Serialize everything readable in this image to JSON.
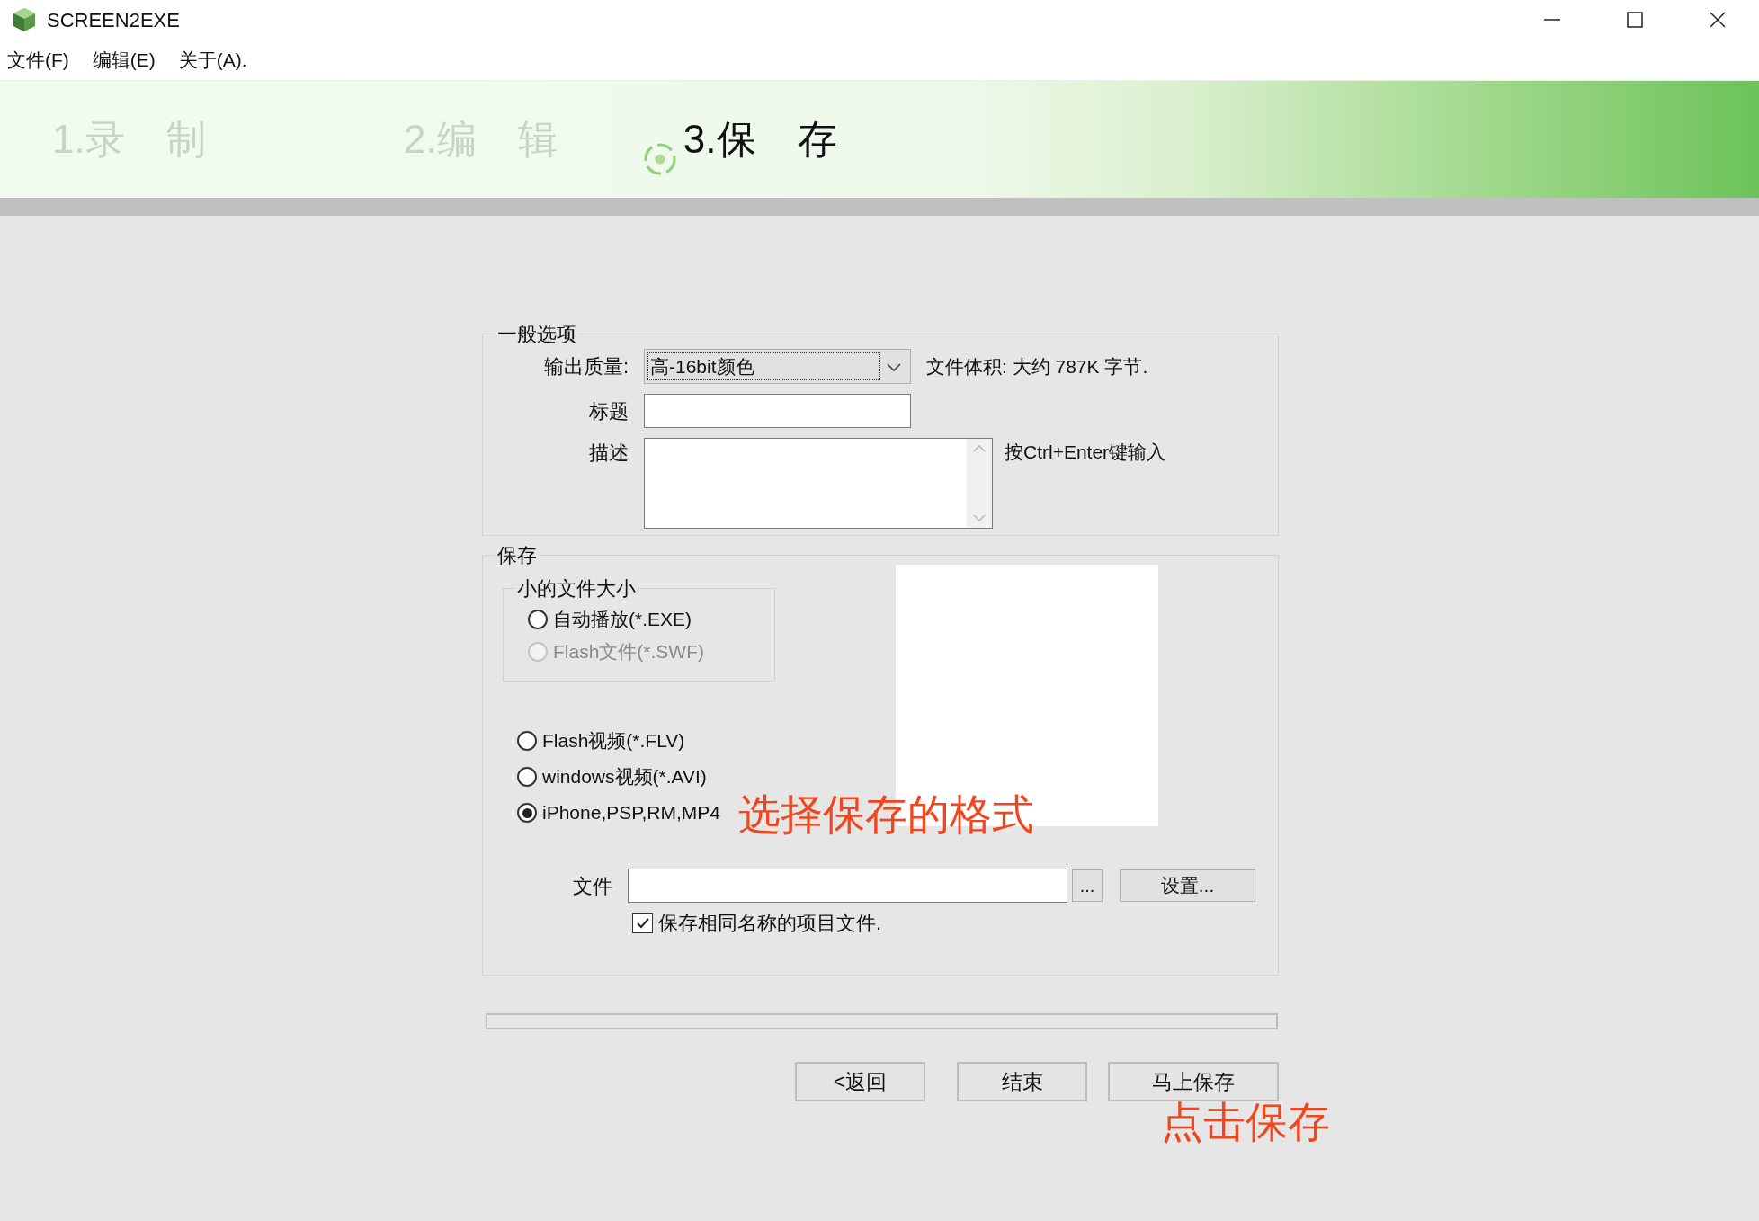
{
  "window": {
    "title": "SCREEN2EXE"
  },
  "menu": [
    {
      "label": "文件(F)"
    },
    {
      "label": "编辑(E)"
    },
    {
      "label": "关于(A)."
    }
  ],
  "steps": [
    {
      "label": "1.录 制",
      "selected": false
    },
    {
      "label": "2.编 辑",
      "selected": false
    },
    {
      "label": "3.保 存",
      "selected": true
    }
  ],
  "general": {
    "title": "一般选项",
    "quality_label": "输出质量:",
    "quality": "高-16bit颜色",
    "file_size": "文件体积: 大约 787K 字节.",
    "title_label": "标题",
    "description_label": "描述",
    "hint": "按Ctrl+Enter键输入"
  },
  "save": {
    "title": "保存",
    "small_group": {
      "title": "小的文件大小",
      "options": [
        {
          "label": "自动播放(*.EXE)",
          "selected": false,
          "disabled": false
        },
        {
          "label": "Flash文件(*.SWF)",
          "selected": false,
          "disabled": true
        }
      ]
    },
    "options": [
      {
        "label": "Flash视频(*.FLV)",
        "selected": false,
        "disabled": false
      },
      {
        "label": "windows视频(*.AVI)",
        "selected": false,
        "disabled": false
      },
      {
        "label": "iPhone,PSP,RM,MP4",
        "selected": true,
        "disabled": false
      }
    ],
    "file_label": "文件",
    "browse": "...",
    "settings": "设置...",
    "same_name": {
      "label": "保存相同名称的项目文件.",
      "checked": true
    }
  },
  "progress": {
    "level": 0
  },
  "buttons": [
    "<返回",
    "结束",
    "马上保存"
  ],
  "annotations": [
    {
      "text": "选择保存的格式"
    },
    {
      "text": "点击保存"
    }
  ]
}
